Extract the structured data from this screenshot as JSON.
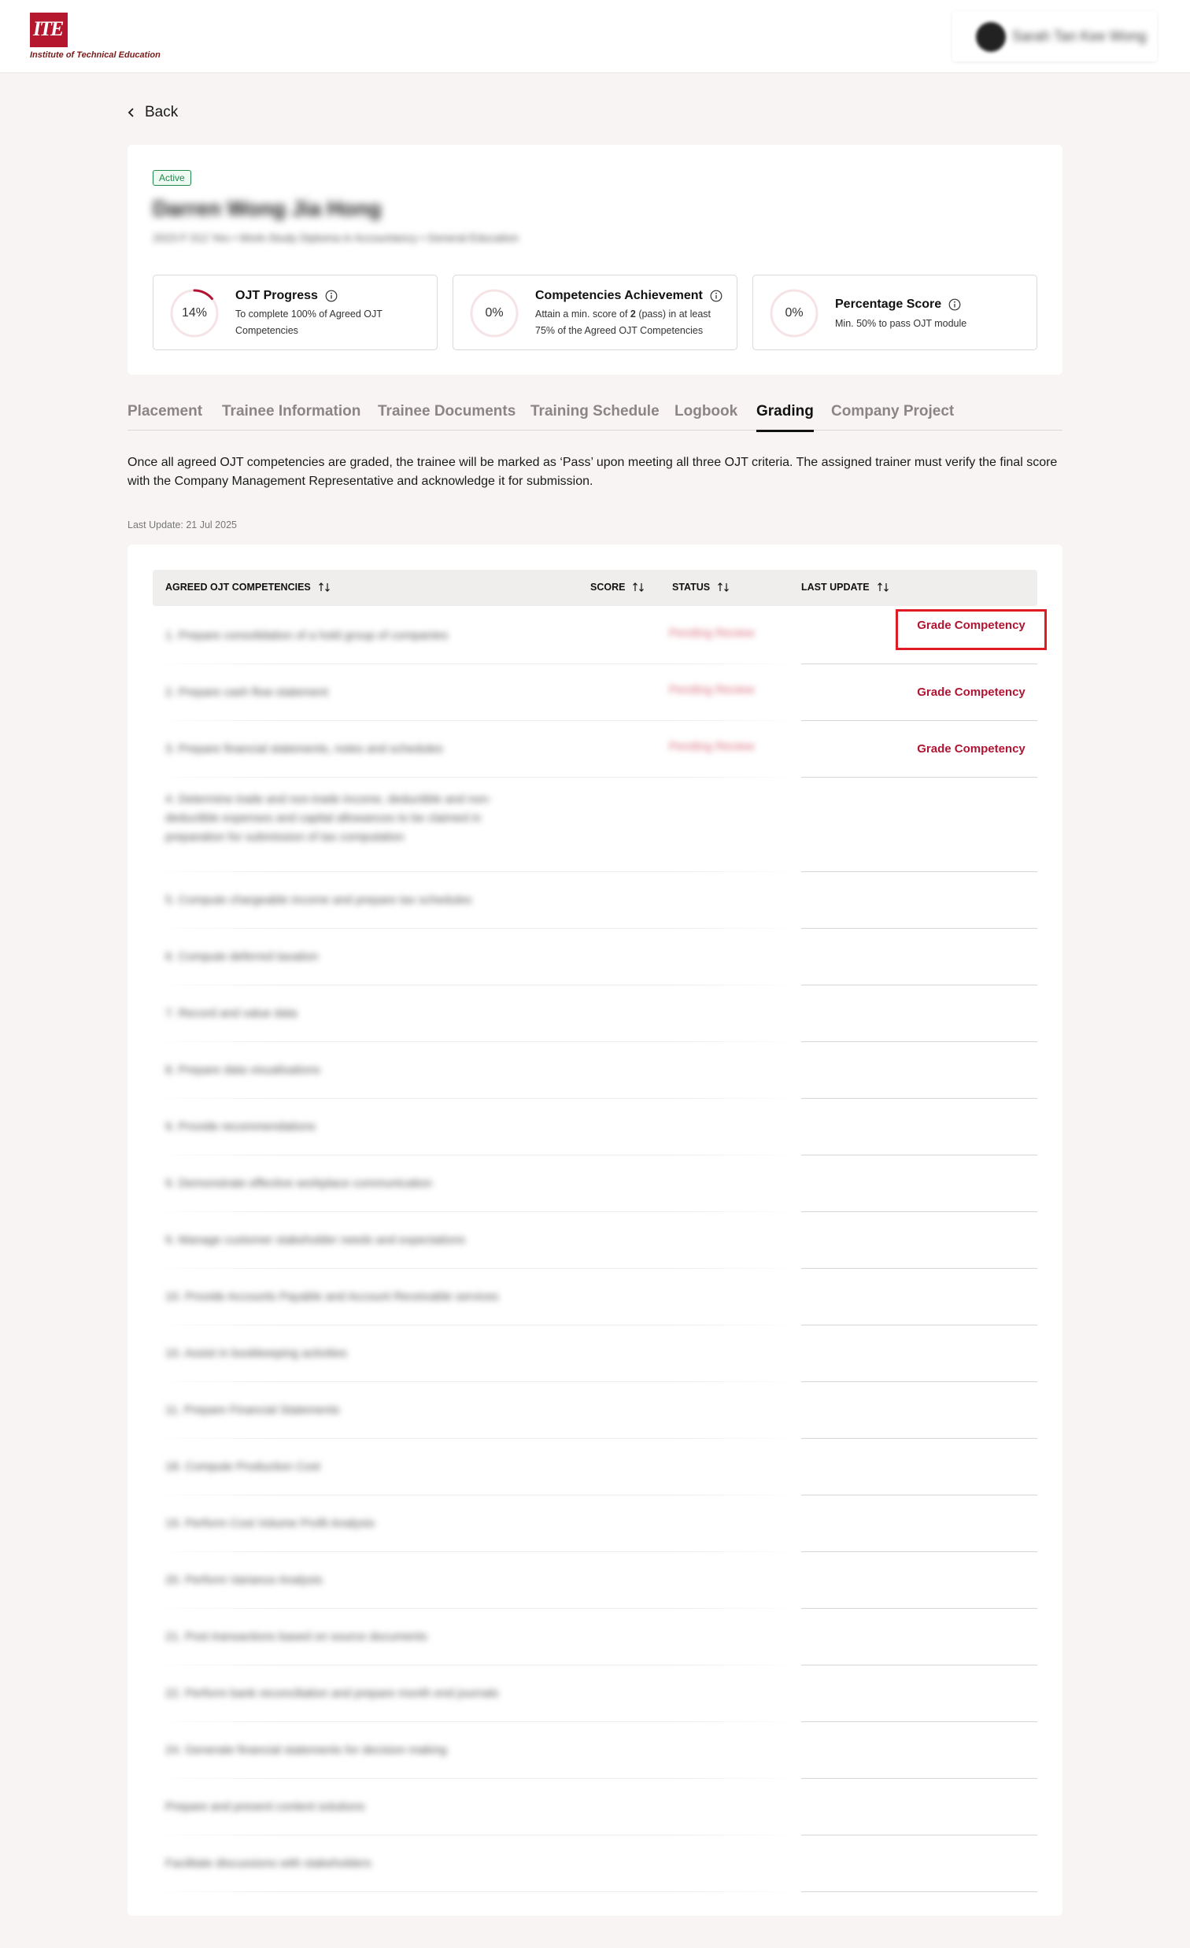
{
  "header": {
    "logo_mark": "ITE",
    "logo_text": "Institute of Technical Education",
    "user_name": "Sarah Tan Kee Wong"
  },
  "nav": {
    "back_label": "Back"
  },
  "profile": {
    "status": "Active",
    "name": "Darren Wong Jia Hong",
    "meta": "2023 F 012 Yes  •  Work-Study Diploma in Accountancy  •  General Education"
  },
  "stats": [
    {
      "ring_value": "14%",
      "progress": 0.14,
      "title": "OJT Progress",
      "desc": "To complete 100% of Agreed OJT Competencies"
    },
    {
      "ring_value": "0%",
      "progress": 0,
      "title": "Competencies Achievement",
      "desc_pre": "Attain a min. score of ",
      "desc_bold": "2",
      "desc_post": " (pass) in at least 75% of the Agreed OJT Competencies"
    },
    {
      "ring_value": "0%",
      "progress": 0,
      "title": "Percentage Score",
      "desc": "Min. 50% to pass OJT module"
    }
  ],
  "tabs": [
    {
      "label": "Placement"
    },
    {
      "label": "Trainee Information"
    },
    {
      "label": "Trainee Documents"
    },
    {
      "label": "Training Schedule"
    },
    {
      "label": "Logbook"
    },
    {
      "label": "Grading"
    },
    {
      "label": "Company Project"
    }
  ],
  "active_tab": "Grading",
  "grading": {
    "intro": "Once all agreed OJT competencies are graded, the trainee will be marked as ‘Pass’ upon meeting all three OJT criteria. The assigned trainer must verify the final score with the Company Management Representative and acknowledge it for submission.",
    "last_update": "Last Update: 21 Jul 2025",
    "columns": {
      "competency": "AGREED OJT COMPETENCIES",
      "score": "SCORE",
      "status": "STATUS",
      "last_update": "LAST UPDATE"
    },
    "grade_label": "Grade Competency",
    "rows": [
      {
        "name": "1. Prepare consolidation of a hold group of companies",
        "status": "Pending Review",
        "grade": true
      },
      {
        "name": "2. Prepare cash flow statement",
        "status": "Pending Review",
        "grade": true
      },
      {
        "name": "3. Prepare financial statements, notes and schedules",
        "status": "Pending Review",
        "grade": true
      },
      {
        "name": "4. Determine trade and non-trade income, deductible and non-deductible expenses and capital allowances to be claimed in preparation for submission of tax computation",
        "status": "",
        "grade": false
      },
      {
        "name": "5. Compute chargeable income and prepare tax schedules",
        "status": "",
        "grade": false
      },
      {
        "name": "6. Compute deferred taxation",
        "status": "",
        "grade": false
      },
      {
        "name": "7. Record and value data",
        "status": "",
        "grade": false
      },
      {
        "name": "8. Prepare data visualisations",
        "status": "",
        "grade": false
      },
      {
        "name": "9. Provide recommendations",
        "status": "",
        "grade": false
      },
      {
        "name": "9. Demonstrate effective workplace communication",
        "status": "",
        "grade": false
      },
      {
        "name": "9. Manage customer stakeholder needs and expectations",
        "status": "",
        "grade": false
      },
      {
        "name": "10. Provide Accounts Payable and Account Receivable services",
        "status": "",
        "grade": false
      },
      {
        "name": "10. Assist in bookkeeping activities",
        "status": "",
        "grade": false
      },
      {
        "name": "11. Prepare Financial Statements",
        "status": "",
        "grade": false
      },
      {
        "name": "18. Compute Production Cost",
        "status": "",
        "grade": false
      },
      {
        "name": "19. Perform Cost Volume Profit Analysis",
        "status": "",
        "grade": false
      },
      {
        "name": "20. Perform Variance Analysis",
        "status": "",
        "grade": false
      },
      {
        "name": "21. Post transactions based on source documents",
        "status": "",
        "grade": false
      },
      {
        "name": "22. Perform bank reconciliation and prepare month end journals",
        "status": "",
        "grade": false
      },
      {
        "name": "24. Generate financial statements for decision making",
        "status": "",
        "grade": false
      },
      {
        "name": "Prepare and present content solutions",
        "status": "",
        "grade": false
      },
      {
        "name": "Facilitate discussions with stakeholders",
        "status": "",
        "grade": false
      }
    ]
  },
  "colors": {
    "accent": "#b01432",
    "ring_active": "#b01432",
    "ring_track": "#f6e3e6",
    "active_badge": "#1f8a4c",
    "highlight_box": "#e01b24"
  }
}
